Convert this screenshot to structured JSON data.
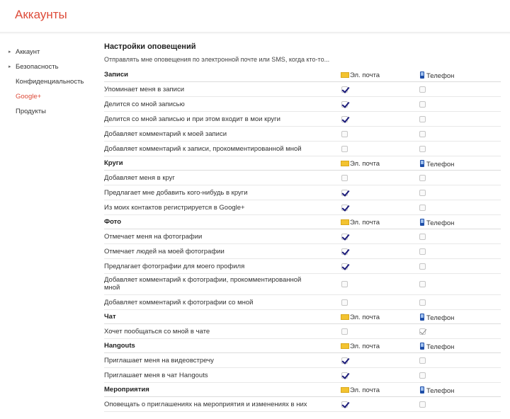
{
  "header": {
    "title": "Аккаунты"
  },
  "sidebar": {
    "items": [
      {
        "label": "Аккаунт",
        "arrow": true,
        "active": false
      },
      {
        "label": "Безопасность",
        "arrow": true,
        "active": false
      },
      {
        "label": "Конфиденциальность",
        "arrow": false,
        "active": false
      },
      {
        "label": "Google+",
        "arrow": false,
        "active": true
      },
      {
        "label": "Продукты",
        "arrow": false,
        "active": false
      }
    ]
  },
  "main": {
    "title": "Настройки оповещений",
    "intro": "Отправлять мне оповещения по электронной почте или SMS, когда кто-то...",
    "email_label": "Эл. почта",
    "phone_label": "Телефон",
    "groups": [
      {
        "name": "Записи",
        "rows": [
          {
            "label": "Упоминает меня в записи",
            "email": true,
            "phone": false
          },
          {
            "label": "Делится со мной записью",
            "email": true,
            "phone": false
          },
          {
            "label": "Делится со мной записью и при этом входит в мои круги",
            "email": true,
            "phone": false
          },
          {
            "label": "Добавляет комментарий к моей записи",
            "email": false,
            "phone": false
          },
          {
            "label": "Добавляет комментарий к записи, прокомментированной мной",
            "email": false,
            "phone": false
          }
        ]
      },
      {
        "name": "Круги",
        "rows": [
          {
            "label": "Добавляет меня в круг",
            "email": false,
            "phone": false
          },
          {
            "label": "Предлагает мне добавить кого-нибудь в круги",
            "email": true,
            "phone": false
          },
          {
            "label": "Из моих контактов регистрируется в Google+",
            "email": true,
            "phone": false
          }
        ]
      },
      {
        "name": "Фото",
        "rows": [
          {
            "label": "Отмечает меня на фотографии",
            "email": true,
            "phone": false
          },
          {
            "label": "Отмечает людей на моей фотографии",
            "email": true,
            "phone": false
          },
          {
            "label": "Предлагает фотографии для моего профиля",
            "email": true,
            "phone": false
          },
          {
            "label": "Добавляет комментарий к фотографии, прокомментированной мной",
            "email": false,
            "phone": false,
            "tall": true
          },
          {
            "label": "Добавляет комментарий к фотографии со мной",
            "email": false,
            "phone": false
          }
        ]
      },
      {
        "name": "Чат",
        "rows": [
          {
            "label": "Хочет пообщаться со мной в чате",
            "email": false,
            "phone": true,
            "phone_grey": true
          }
        ]
      },
      {
        "name": "Hangouts",
        "rows": [
          {
            "label": "Приглашает меня на видеовстречу",
            "email": true,
            "phone": false
          },
          {
            "label": "Приглашает меня в чат Hangouts",
            "email": true,
            "phone": false
          }
        ]
      },
      {
        "name": "Мероприятия",
        "rows": [
          {
            "label": "Оповещать о приглашениях на мероприятия и изменениях в них",
            "email": true,
            "phone": false
          }
        ]
      }
    ]
  }
}
